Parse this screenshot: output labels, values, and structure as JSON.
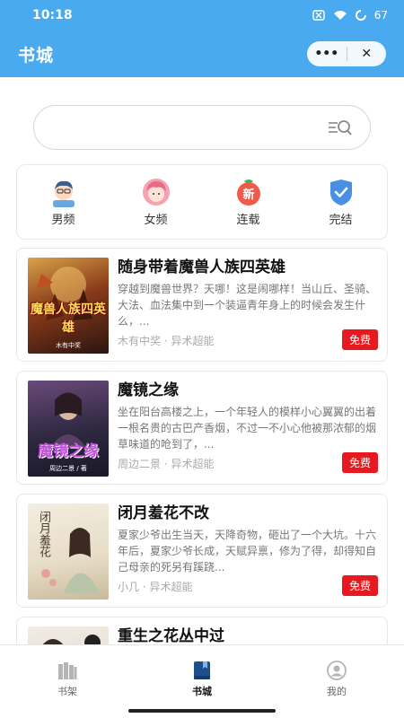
{
  "status_bar": {
    "time": "10:18",
    "battery": "67",
    "icons": [
      "sim-off-icon",
      "wifi-icon",
      "battery-icon"
    ]
  },
  "header": {
    "title": "书城",
    "capsule_more": "•••",
    "capsule_close": "✕"
  },
  "search": {
    "placeholder": "",
    "icon": "search-list-icon"
  },
  "categories": [
    {
      "label": "男频",
      "icon": "male-avatar-icon"
    },
    {
      "label": "女频",
      "icon": "female-avatar-icon"
    },
    {
      "label": "连载",
      "icon": "new-badge-icon",
      "icon_text": "新"
    },
    {
      "label": "完结",
      "icon": "check-shield-icon"
    }
  ],
  "books": [
    {
      "title": "随身带着魔兽人族四英雄",
      "description": "穿越到魔兽世界？天哪！这是闹哪样！当山丘、圣骑、大法、血法集中到一个装逼青年身上的时候会发生什么，...",
      "author": "木有中奖",
      "genre": "异术超能",
      "badge": "免费",
      "cover_text": "魔兽人族四英雄",
      "cover_small": "木有中奖"
    },
    {
      "title": "魔镜之缘",
      "description": "坐在阳台高楼之上，一个年轻人的模样小心翼翼的出着一根名贵的古巴产香烟，不过一不小心他被那浓郁的烟草味道的呛到了，...",
      "author": "周边二景",
      "genre": "异术超能",
      "badge": "免费",
      "cover_text": "魔镜之缘",
      "cover_small": "周边二景 / 著"
    },
    {
      "title": "闭月羞花不改",
      "description": "夏家少爷出生当天，天降奇物，砸出了一个大坑。十六年后，夏家少爷长成，天赋异禀，修为了得，却得知自己母亲的死另有蹊跷...",
      "author": "小几",
      "genre": "异术超能",
      "badge": "免费",
      "cover_text": "闭月羞花",
      "cover_small": ""
    },
    {
      "title": "重生之花丛中过",
      "description": "",
      "author": "",
      "genre": "",
      "badge": "",
      "cover_text": "",
      "cover_small": ""
    }
  ],
  "tab_bar": [
    {
      "label": "书架",
      "icon": "bookshelf-icon",
      "active": false
    },
    {
      "label": "书城",
      "icon": "book-icon",
      "active": true
    },
    {
      "label": "我的",
      "icon": "profile-icon",
      "active": false
    }
  ],
  "colors": {
    "primary": "#4aaaf0",
    "badge": "#e8191e",
    "active_tab_icon": "#1f4e8c"
  }
}
